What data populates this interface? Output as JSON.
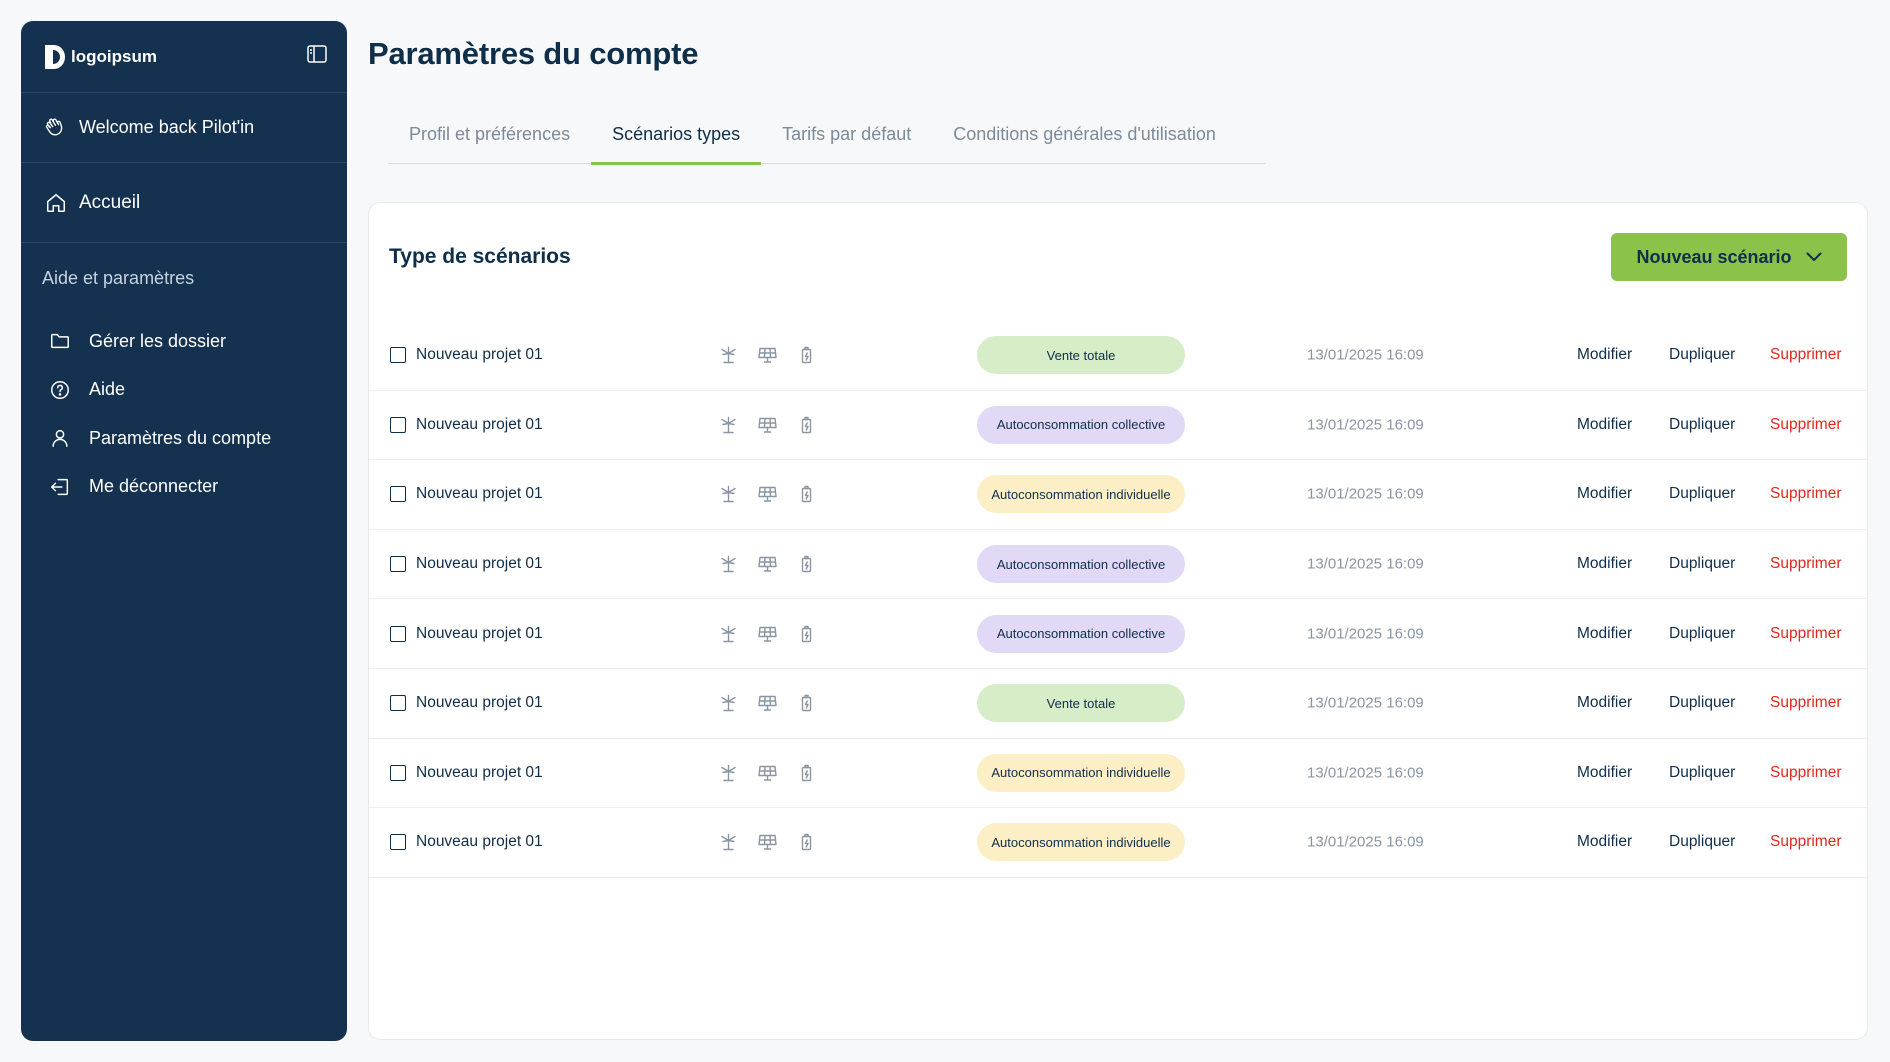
{
  "sidebar": {
    "logo_text": "logoipsum",
    "logo_mark": "®",
    "welcome": "Welcome back Pilot'in",
    "home": "Accueil",
    "section_title": "Aide et paramètres",
    "menu": [
      {
        "label": "Gérer les dossier",
        "icon": "folder-icon"
      },
      {
        "label": "Aide",
        "icon": "help-circle-icon"
      },
      {
        "label": "Paramètres du compte",
        "icon": "user-icon"
      },
      {
        "label": "Me déconnecter",
        "icon": "logout-icon"
      }
    ]
  },
  "page": {
    "title": "Paramètres du compte"
  },
  "tabs": [
    {
      "label": "Profil et préférences",
      "active": false
    },
    {
      "label": "Scénarios types",
      "active": true
    },
    {
      "label": "Tarifs par défaut",
      "active": false
    },
    {
      "label": "Conditions générales d'utilisation",
      "active": false
    }
  ],
  "card": {
    "title": "Type de scénarios",
    "new_button": "Nouveau scénario"
  },
  "actions": {
    "modify": "Modifier",
    "duplicate": "Dupliquer",
    "delete": "Supprimer"
  },
  "rows": [
    {
      "name": "Nouveau projet 01",
      "badge": "Vente totale",
      "badge_color": "green",
      "date": "13/01/2025 16:09"
    },
    {
      "name": "Nouveau projet 01",
      "badge": "Autoconsommation collective",
      "badge_color": "purple",
      "date": "13/01/2025 16:09"
    },
    {
      "name": "Nouveau projet 01",
      "badge": "Autoconsommation individuelle",
      "badge_color": "yellow",
      "date": "13/01/2025 16:09"
    },
    {
      "name": "Nouveau projet 01",
      "badge": "Autoconsommation collective",
      "badge_color": "purple",
      "date": "13/01/2025 16:09"
    },
    {
      "name": "Nouveau projet 01",
      "badge": "Autoconsommation collective",
      "badge_color": "purple",
      "date": "13/01/2025 16:09"
    },
    {
      "name": "Nouveau projet 01",
      "badge": "Vente totale",
      "badge_color": "green",
      "date": "13/01/2025 16:09"
    },
    {
      "name": "Nouveau projet 01",
      "badge": "Autoconsommation individuelle",
      "badge_color": "yellow",
      "date": "13/01/2025 16:09"
    },
    {
      "name": "Nouveau projet 01",
      "badge": "Autoconsommation individuelle",
      "badge_color": "yellow",
      "date": "13/01/2025 16:09"
    }
  ],
  "colors": {
    "sidebar_bg": "#14314f",
    "accent_green": "#8bc34a",
    "delete_red": "#e3271c",
    "badge_green": "#d6edc8",
    "badge_purple": "#e1d9f6",
    "badge_yellow": "#fcefc6"
  }
}
